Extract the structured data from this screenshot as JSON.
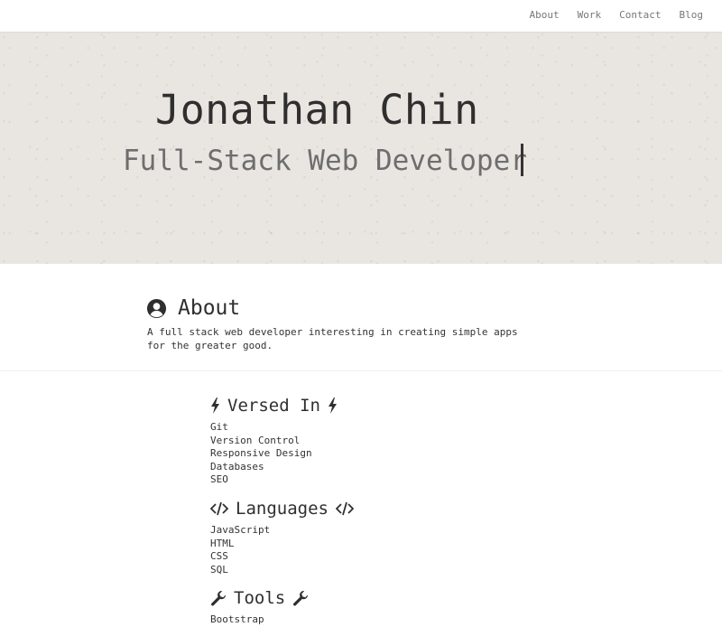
{
  "nav": {
    "links": [
      "About",
      "Work",
      "Contact",
      "Blog"
    ]
  },
  "hero": {
    "name": "Jonathan Chin",
    "role": "Full-Stack Web Developer"
  },
  "about": {
    "heading": "About",
    "icon": "user-circle-icon",
    "text": "A full stack web developer interesting in creating simple apps for the greater good."
  },
  "skills": {
    "versed": {
      "heading": "Versed In",
      "icon": "bolt-icon",
      "items": [
        "Git",
        "Version Control",
        "Responsive Design",
        "Databases",
        "SEO"
      ]
    },
    "languages": {
      "heading": "Languages",
      "icon": "code-icon",
      "items": [
        "JavaScript",
        "HTML",
        "CSS",
        "SQL"
      ]
    },
    "tools": {
      "heading": "Tools",
      "icon": "wrench-icon",
      "items": [
        "Bootstrap"
      ]
    }
  }
}
